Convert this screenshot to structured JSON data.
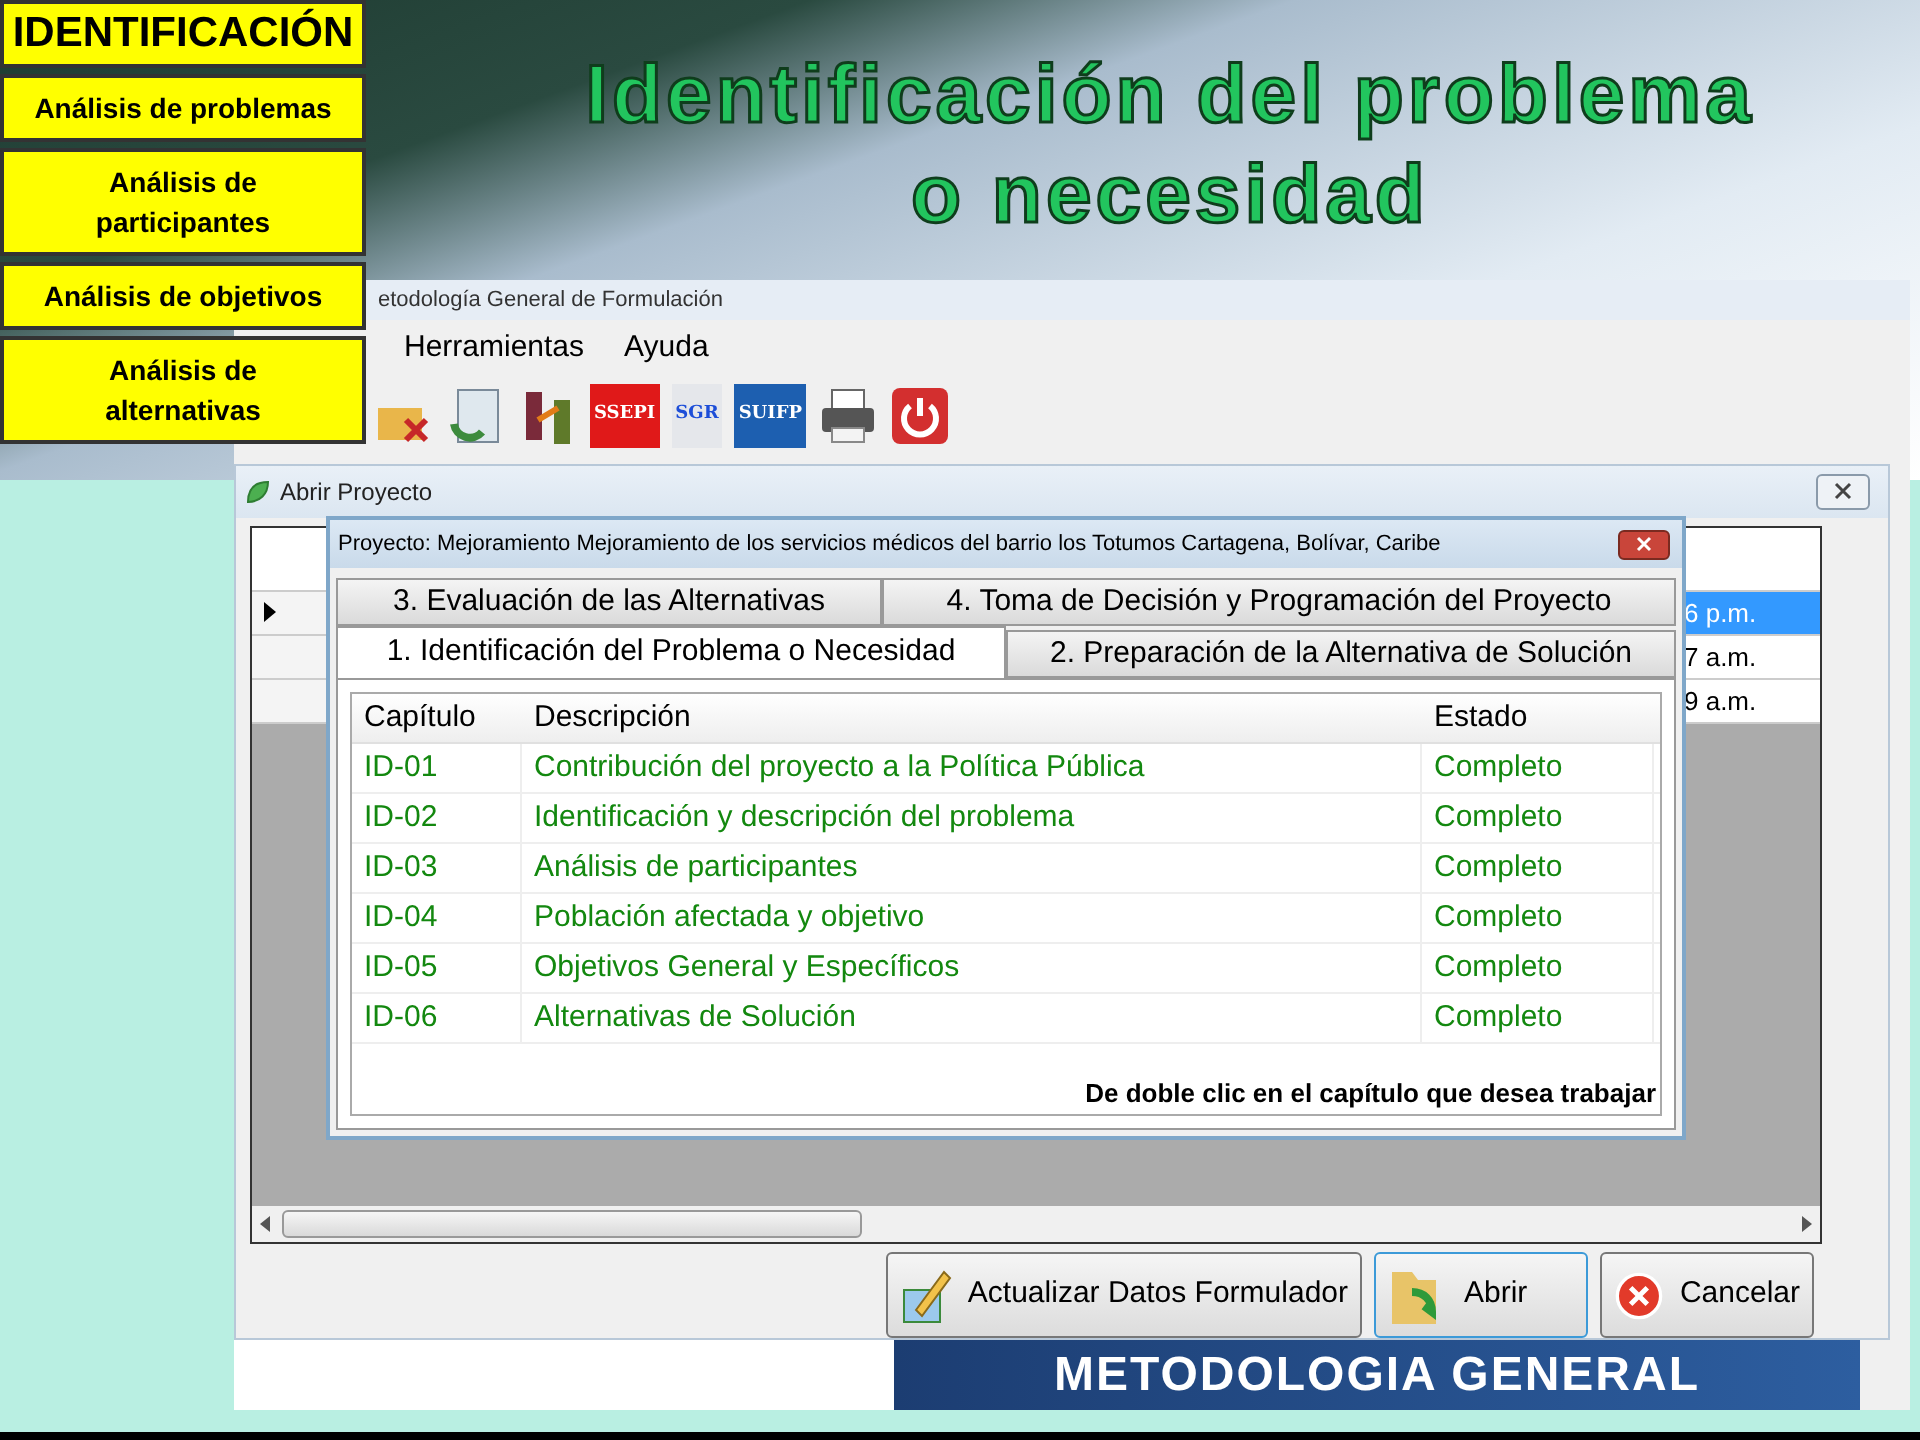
{
  "side_menu": [
    {
      "label": "IDENTIFICACIÓN",
      "kind": "header"
    },
    {
      "label": "Análisis de problemas",
      "kind": "item"
    },
    {
      "label": "Análisis de participantes",
      "kind": "wrapped"
    },
    {
      "label": "Análisis de objetivos",
      "kind": "item"
    },
    {
      "label": "Análisis de alternativas",
      "kind": "wrapped"
    }
  ],
  "slide_title": [
    "Identificación del problema",
    "o necesidad"
  ],
  "app": {
    "title": "etodología General de Formulación",
    "menu": [
      "Herramientas",
      "Ayuda"
    ],
    "toolbar_logos": [
      "SSEPI",
      "SGR",
      "SUIFP"
    ]
  },
  "open_dialog": {
    "title": "Abrir Proyecto",
    "grid_rows": [
      {
        "selected": true,
        "time": "6 p.m."
      },
      {
        "selected": false,
        "time": "7 a.m."
      },
      {
        "selected": false,
        "time": "9 a.m."
      }
    ],
    "buttons": [
      "Actualizar Datos Formulador",
      "Abrir",
      "Cancelar"
    ]
  },
  "project_dialog": {
    "title": "Proyecto: Mejoramiento Mejoramiento de los servicios médicos del barrio los Totumos Cartagena, Bolívar, Caribe",
    "tab_rows": [
      [
        {
          "label": "3. Evaluación de las Alternativas",
          "selected": false
        },
        {
          "label": "4. Toma de Decisión y Programación del Proyecto",
          "selected": false
        }
      ],
      [
        {
          "label": "1. Identificación del Problema o Necesidad",
          "selected": true
        },
        {
          "label": "2. Preparación de la Alternativa de Solución",
          "selected": false
        }
      ]
    ],
    "columns": [
      "Capítulo",
      "Descripción",
      "Estado"
    ],
    "rows": [
      [
        "ID-01",
        "Contribución del proyecto a la Política Pública",
        "Completo"
      ],
      [
        "ID-02",
        "Identificación y descripción del problema",
        "Completo"
      ],
      [
        "ID-03",
        "Análisis de participantes",
        "Completo"
      ],
      [
        "ID-04",
        "Población afectada y objetivo",
        "Completo"
      ],
      [
        "ID-05",
        "Objetivos General y Específicos",
        "Completo"
      ],
      [
        "ID-06",
        "Alternativas de Solución",
        "Completo"
      ]
    ],
    "hint": "De doble clic en el capítulo que desea trabajar"
  },
  "banner": "METODOLOGIA GENERAL"
}
